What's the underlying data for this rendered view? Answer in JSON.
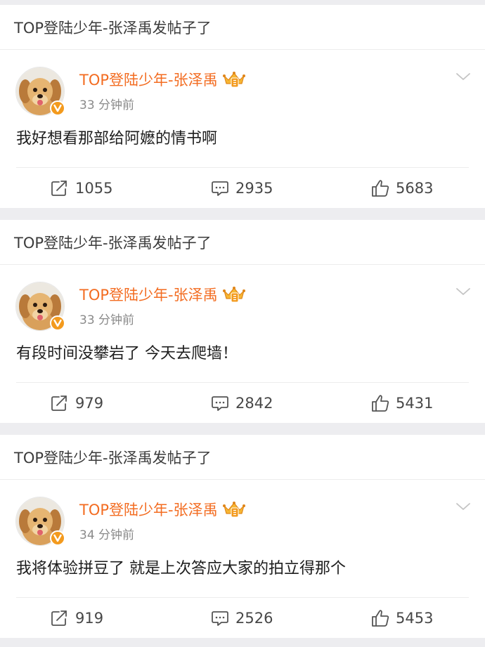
{
  "colors": {
    "username": "#f36c21",
    "badge": "#f39a1d",
    "page_bg": "#ededf0"
  },
  "cards": [
    {
      "header": "TOP登陆少年-张泽禹发帖子了",
      "author": "TOP登陆少年-张泽禹",
      "time": "33 分钟前",
      "text": "我好想看那部给阿嬷的情书啊",
      "reposts": "1055",
      "comments": "2935",
      "likes": "5683"
    },
    {
      "header": "TOP登陆少年-张泽禹发帖子了",
      "author": "TOP登陆少年-张泽禹",
      "time": "33 分钟前",
      "text": "有段时间没攀岩了 今天去爬墙！",
      "reposts": "979",
      "comments": "2842",
      "likes": "5431"
    },
    {
      "header": "TOP登陆少年-张泽禹发帖子了",
      "author": "TOP登陆少年-张泽禹",
      "time": "34 分钟前",
      "text": "我将体验拼豆了 就是上次答应大家的拍立得那个",
      "reposts": "919",
      "comments": "2526",
      "likes": "5453"
    }
  ],
  "icons": {
    "avatar": "puppy-avatar",
    "verified": "verified-v-icon",
    "member": "crown-member-icon",
    "more": "chevron-down-icon",
    "repost": "repost-icon",
    "comment": "comment-icon",
    "like": "like-icon"
  }
}
